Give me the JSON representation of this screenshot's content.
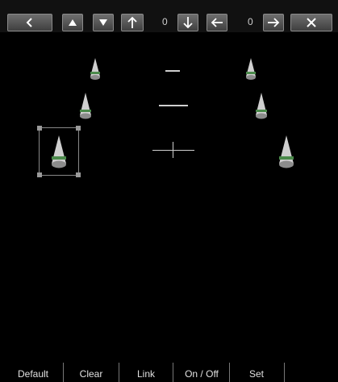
{
  "toolbar": {
    "back_icon": "chevron-left-icon",
    "up_icon": "triangle-up-icon",
    "down_icon": "triangle-down-icon",
    "front_icon": "arrow-up-icon",
    "front_rear_value": "0",
    "rear_icon": "arrow-down-icon",
    "left_icon": "arrow-left-icon",
    "left_right_value": "0",
    "right_icon": "arrow-right-icon",
    "close_icon": "close-icon"
  },
  "bottom_bar": {
    "items": [
      {
        "label": "Default"
      },
      {
        "label": "Clear"
      },
      {
        "label": "Link"
      },
      {
        "label": "On / Off"
      },
      {
        "label": "Set"
      }
    ]
  },
  "speakers": {
    "names": [
      "front-left-high",
      "front-right-high",
      "front-left",
      "front-right",
      "rear-left",
      "rear-right"
    ]
  },
  "colors": {
    "button_gradient_top": "#6e6e6e",
    "button_gradient_bottom": "#3f3f3f",
    "speaker_band": "#4b8a4b",
    "background": "#000000"
  }
}
